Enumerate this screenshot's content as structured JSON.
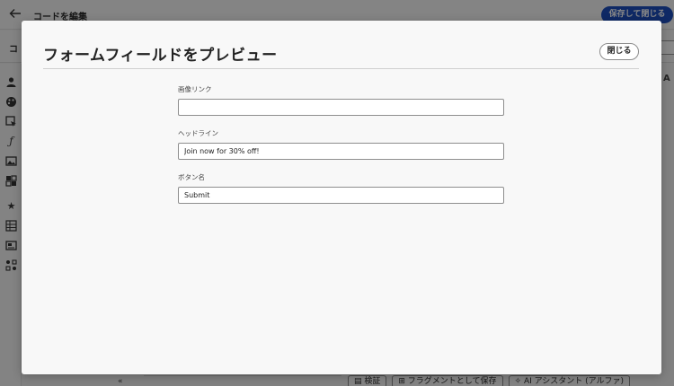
{
  "app": {
    "title": "コードを編集",
    "save_close_label": "保存して閉じる",
    "subbar_text": "コ",
    "right_edge_text": "A",
    "rail_icons": [
      "person-icon",
      "palette-icon",
      "cursor-select-icon",
      "function-icon",
      "image-icon",
      "layout-icon",
      "star-icon",
      "table-icon",
      "card-icon",
      "flow-icon"
    ],
    "bottom_chevron": "«",
    "bottom_tools": [
      {
        "icon": "document-icon",
        "label": "検証"
      },
      {
        "icon": "fragment-icon",
        "label": "フラグメントとして保存"
      },
      {
        "icon": "ai-icon",
        "label": "AI アシスタント (アルファ)"
      }
    ]
  },
  "modal": {
    "title": "フォームフィールドをプレビュー",
    "close_label": "閉じる",
    "fields": [
      {
        "label": "画像リンク",
        "value": "",
        "placeholder": ""
      },
      {
        "label": "ヘッドライン",
        "value": "Join now for 30% off!",
        "placeholder": ""
      },
      {
        "label": "ボタン名",
        "value": "Submit",
        "placeholder": ""
      }
    ]
  },
  "colors": {
    "accent": "#1d4fbf",
    "overlay": "rgba(0,0,0,0.47)",
    "modal_bg": "#f8f8f8"
  }
}
